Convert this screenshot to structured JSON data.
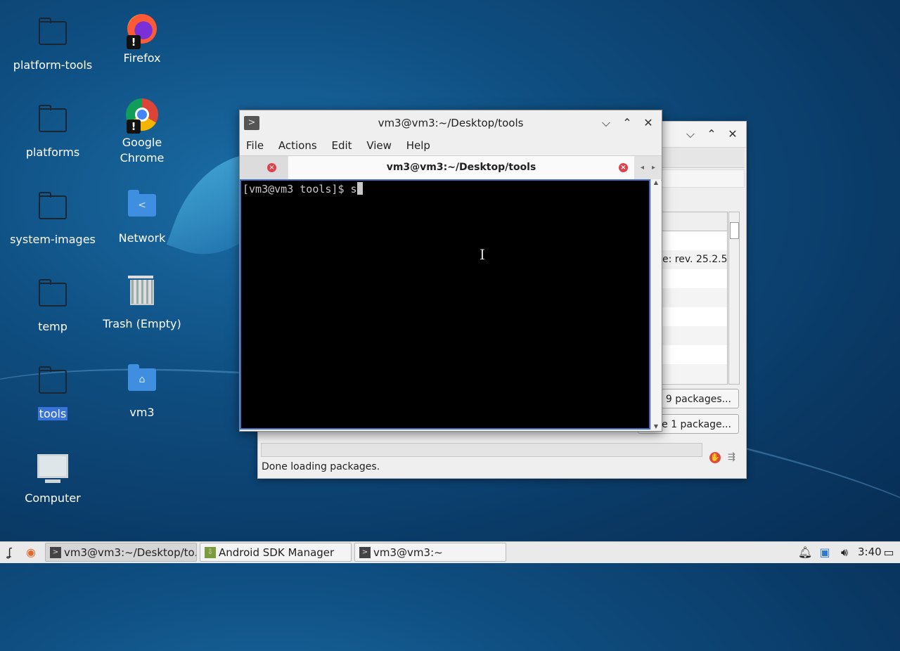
{
  "desktop": {
    "icons": [
      {
        "label": "platform-tools"
      },
      {
        "label": "Firefox"
      },
      {
        "label": "platforms"
      },
      {
        "label": "Google Chrome"
      },
      {
        "label": "system-images"
      },
      {
        "label": "Network"
      },
      {
        "label": "temp"
      },
      {
        "label": "Trash (Empty)"
      },
      {
        "label": "tools"
      },
      {
        "label": "vm3"
      },
      {
        "label": "Computer"
      }
    ]
  },
  "sdk_manager": {
    "row_text": "e: rev. 25.2.5",
    "install_button": "all 9 packages...",
    "delete_button": "ete 1 package...",
    "status": "Done loading packages."
  },
  "terminal": {
    "title": "vm3@vm3:~/Desktop/tools",
    "menu": [
      "File",
      "Actions",
      "Edit",
      "View",
      "Help"
    ],
    "active_tab": "vm3@vm3:~/Desktop/tools",
    "prompt": "[vm3@vm3 tools]$ s"
  },
  "taskbar": {
    "tasks": [
      {
        "label": "vm3@vm3:~/Desktop/to..."
      },
      {
        "label": "Android SDK Manager"
      },
      {
        "label": "vm3@vm3:~"
      }
    ],
    "clock": "3:40"
  }
}
